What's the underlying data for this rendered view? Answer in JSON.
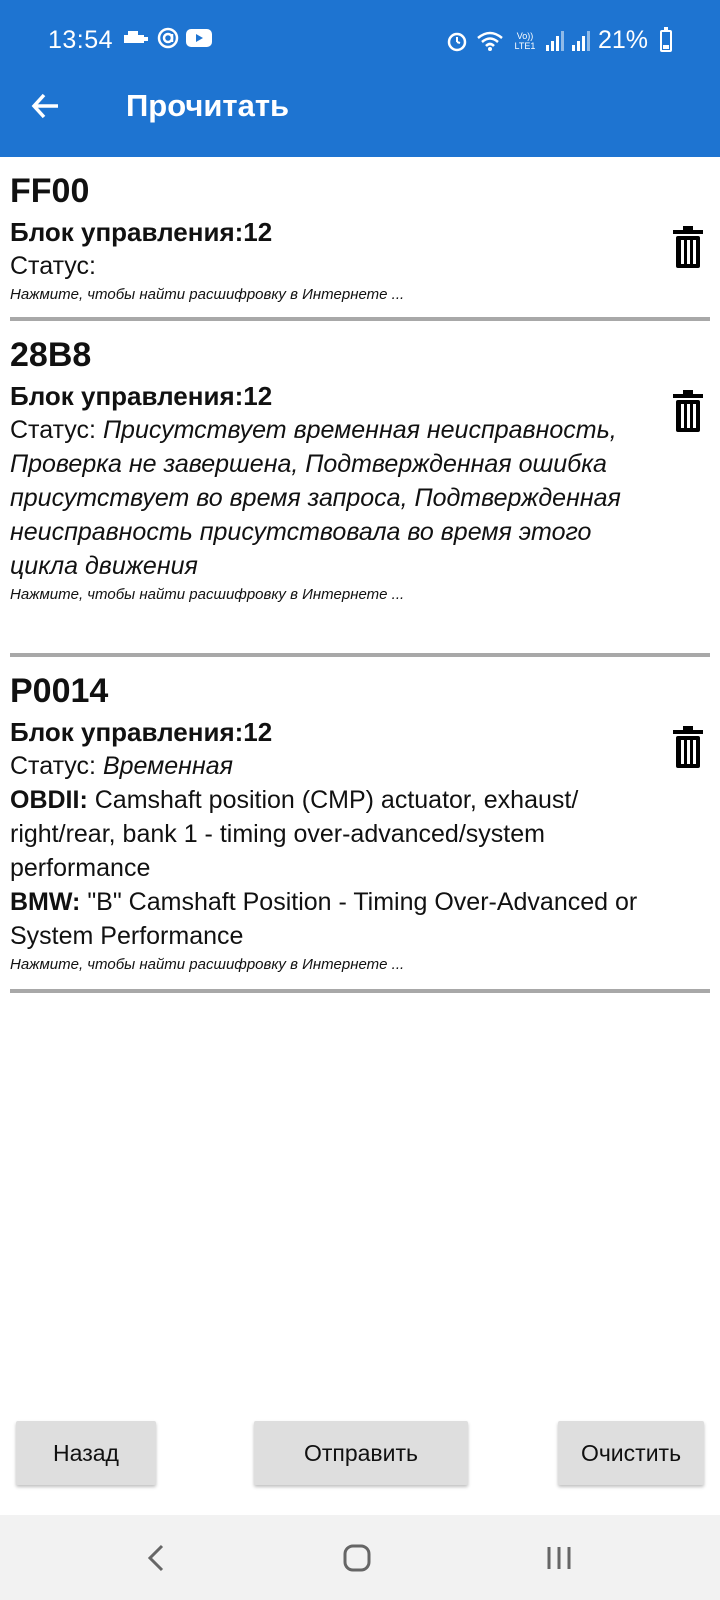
{
  "status_bar": {
    "time": "13:54",
    "left_icons": [
      "car-icon",
      "at-icon",
      "youtube-icon"
    ],
    "right_icons": [
      "alarm-icon",
      "wifi-icon",
      "volte-icon",
      "signal-icon",
      "signal-icon"
    ],
    "volte_text": "Vo)) LTE1",
    "battery": "21%"
  },
  "appbar": {
    "title": "Прочитать"
  },
  "items": [
    {
      "code": "FF00",
      "block": "Блок управления:12",
      "status_label": "Статус:",
      "status_value": "",
      "hint": "Нажмите, чтобы найти расшифровку в Интернете ..."
    },
    {
      "code": "28B8",
      "block": "Блок управления:12",
      "status_label": "Статус:",
      "status_value": "Присутствует временная неисправность, Проверка не завершена, Подтвержденная ошибка присутствует во время запроса, Подтвержденная неисправность присутствовала во время этого цикла движения",
      "hint": "Нажмите, чтобы найти расшифровку в Интернете ..."
    },
    {
      "code": "P0014",
      "block": "Блок управления:12",
      "status_label": "Статус:",
      "status_value": "Временная",
      "desc1_label": "OBDII:",
      "desc1_text": "Camshaft position (CMP) actuator, exhaust/ right/rear, bank 1 - timing over-advanced/system performance",
      "desc2_label": "BMW:",
      "desc2_text": "\"B\" Camshaft Position - Timing Over-Advanced or System Performance",
      "hint": "Нажмите, чтобы найти расшифровку в Интернете ..."
    }
  ],
  "buttons": {
    "back": "Назад",
    "send": "Отправить",
    "clear": "Очистить"
  },
  "nav": [
    "back-nav-icon",
    "home-nav-icon",
    "recents-nav-icon"
  ]
}
